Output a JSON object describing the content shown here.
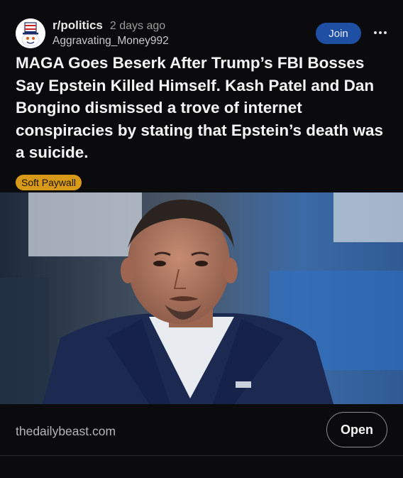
{
  "post": {
    "subreddit": "r/politics",
    "age": "2 days ago",
    "author": "Aggravating_Money992",
    "join_label": "Join",
    "more_icon": "more-horizontal-icon",
    "title": "MAGA Goes Beserk After Trump’s FBI Bosses Say Epstein Killed Himself. Kash Patel and Dan Bongino dismissed a trove of internet conspiracies by stating that Epstein’s death was a suicide.",
    "flair": "Soft Paywall",
    "image_alt": "photo of a man in a navy suit",
    "domain": "thedailybeast.com",
    "open_label": "Open"
  },
  "colors": {
    "background": "#0b0b0d",
    "join": "#1e4fa3",
    "flair": "#d99a1a"
  }
}
